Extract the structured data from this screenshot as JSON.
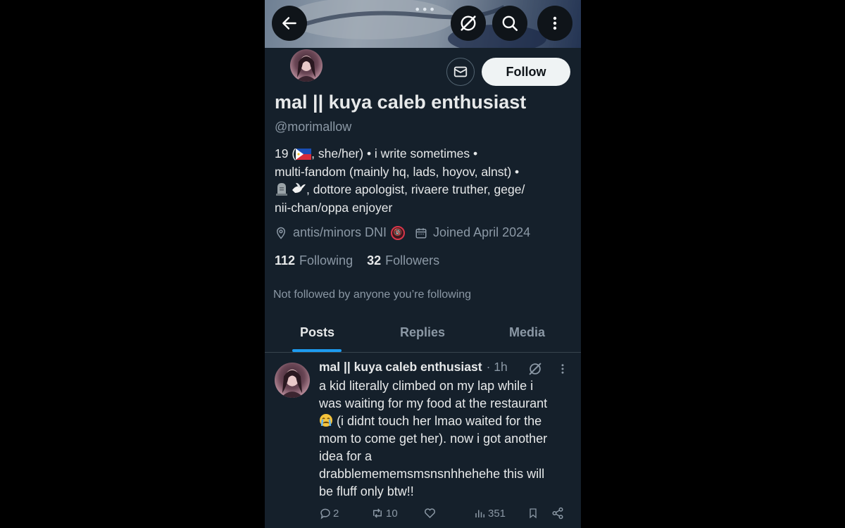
{
  "topbar": {
    "overflow_dots": "•••",
    "back_icon": "arrow-left-icon",
    "grok_icon": "grok-icon",
    "search_icon": "search-icon",
    "more_icon": "more-vertical-icon"
  },
  "profile": {
    "follow_label": "Follow",
    "name": "mal || kuya caleb enthusiast",
    "handle": "@morimallow",
    "bio": {
      "line1_a": "19 (",
      "line1_b": ", she/her) • i write sometimes •",
      "line2": "multi-fandom (mainly hq, lads, hoyov, alnst) •",
      "line3": ", dottore apologist, rivaere truther, gege/",
      "line4": "nii-chan/oppa enjoyer",
      "flag": "philippines-flag",
      "emoji_1": "headstone-emoji",
      "emoji_2": "dove-emoji"
    },
    "location": "antis/minors DNI",
    "location_badge": "🔞",
    "joined": "Joined April 2024",
    "following_count": "112",
    "following_label": "Following",
    "followers_count": "32",
    "followers_label": "Followers",
    "not_followed": "Not followed by anyone you’re following"
  },
  "tabs": [
    "Posts",
    "Replies",
    "Media"
  ],
  "post": {
    "author": "mal || kuya caleb enthusiast",
    "time": "· 1h",
    "line1": "a kid literally climbed on my lap while i",
    "line2": "was waiting for my food at the restaurant",
    "line3": " (i didnt touch her lmao waited for the",
    "line4": "mom to come get her). now i got another",
    "line5": "idea for a",
    "line6": "drabblemememsmsnsnhhehehe this will",
    "line7": "be fluff only btw!!",
    "crying_emoji": "crying-emoji",
    "replies": "2",
    "reposts": "10",
    "views": "351"
  },
  "colors": {
    "background": "#15202b",
    "text": "#e7e9ea",
    "muted": "#8b98a5",
    "accent": "#1d9bf0"
  }
}
